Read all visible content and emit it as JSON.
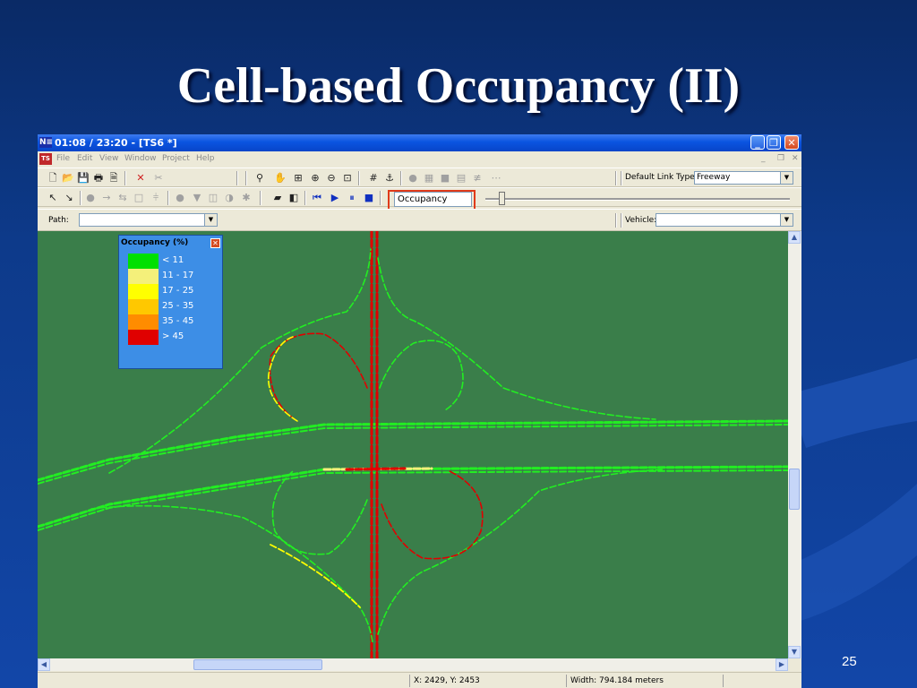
{
  "slide": {
    "title": "Cell-based Occupancy (II)",
    "page_number": "25"
  },
  "window": {
    "title": "01:08 / 23:20 - [TS6 *]",
    "logo": "N≡",
    "doc_icon": "TS",
    "controls": {
      "minimize": "_",
      "restore": "❐",
      "close": "✕"
    }
  },
  "menu": {
    "items": [
      "File",
      "Edit",
      "View",
      "Window",
      "Project",
      "Help"
    ],
    "mdi_controls": {
      "minimize": "_",
      "restore": "❐",
      "close": "✕"
    }
  },
  "toolbar1": {
    "default_link_type_label": "Default Link Type:",
    "default_link_type_value": "Freeway"
  },
  "toolbar2": {
    "display_mode_value": "Occupancy"
  },
  "toolbar3": {
    "path_label": "Path:",
    "path_value": "",
    "vehicle_label": "Vehicle:",
    "vehicle_value": ""
  },
  "legend": {
    "title": "Occupancy (%)",
    "items": [
      {
        "label": "< 11",
        "color": "#00e000"
      },
      {
        "label": "11 - 17",
        "color": "#f4f07a"
      },
      {
        "label": "17 - 25",
        "color": "#ffff00"
      },
      {
        "label": "25 - 35",
        "color": "#ffc800"
      },
      {
        "label": "35 - 45",
        "color": "#ff8c00"
      },
      {
        "label": "> 45",
        "color": "#e00000"
      }
    ]
  },
  "status": {
    "coords": "X: 2429, Y: 2453",
    "width": "Width: 794.184 meters"
  },
  "colors": {
    "map_background": "#3a7e4a",
    "highlight_box": "#e03a1a"
  }
}
